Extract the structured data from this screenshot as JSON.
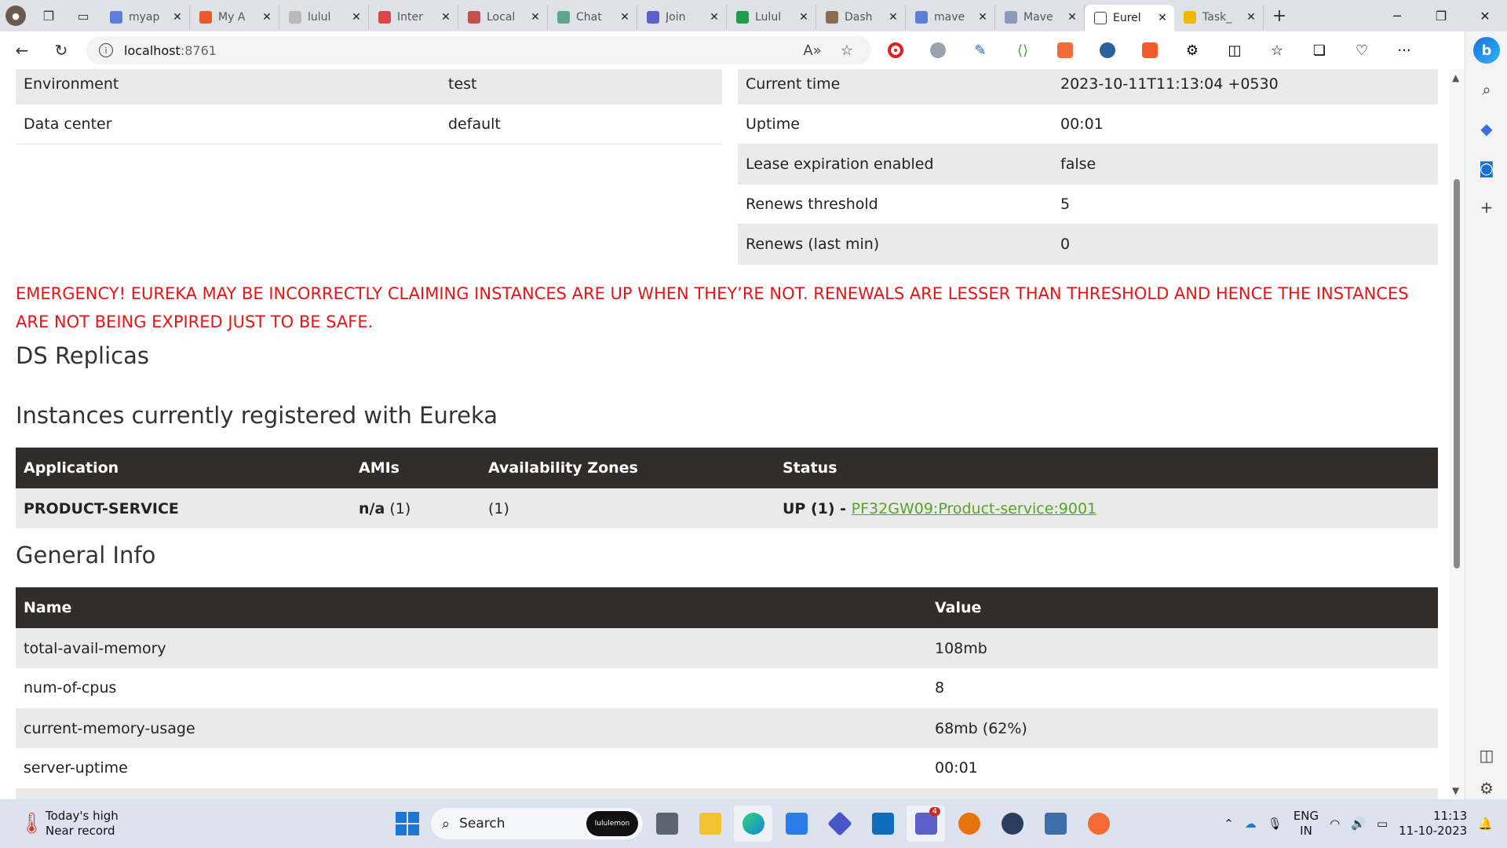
{
  "browser": {
    "tabs": [
      {
        "title": "myap",
        "color": "#5a7fd6",
        "glyph": "search-icon"
      },
      {
        "title": "My A",
        "color": "#e95b2b",
        "glyph": "grid-icon"
      },
      {
        "title": "lulul",
        "color": "#b9b9b9",
        "glyph": "globe-icon"
      },
      {
        "title": "Inter",
        "color": "#d74848",
        "glyph": "gauge-icon"
      },
      {
        "title": "Local",
        "color": "#c4504a",
        "glyph": "pdf-icon"
      },
      {
        "title": "Chat",
        "color": "#5aa88e",
        "glyph": "chat-icon"
      },
      {
        "title": "Join",
        "color": "#5b5fc7",
        "glyph": "teams-icon"
      },
      {
        "title": "Lulul",
        "color": "#1f9d4a",
        "glyph": "sheet-icon"
      },
      {
        "title": "Dash",
        "color": "#8a6c4e",
        "glyph": "person-icon"
      },
      {
        "title": "mave",
        "color": "#5a7fd6",
        "glyph": "search-icon"
      },
      {
        "title": "Mave",
        "color": "#8a9bb5",
        "glyph": "mvn-icon"
      },
      {
        "title": "Eurel",
        "color": "#ffffff",
        "glyph": "page-icon",
        "active": true
      },
      {
        "title": "Task_",
        "color": "#f2b600",
        "glyph": "slides-icon"
      }
    ],
    "address": {
      "host": "localhost",
      "port": ":8761"
    }
  },
  "status_left": [
    {
      "key": "Environment",
      "value": "test"
    },
    {
      "key": "Data center",
      "value": "default"
    }
  ],
  "status_right": [
    {
      "key": "Current time",
      "value": "2023-10-11T11:13:04 +0530"
    },
    {
      "key": "Uptime",
      "value": "00:01"
    },
    {
      "key": "Lease expiration enabled",
      "value": "false"
    },
    {
      "key": "Renews threshold",
      "value": "5"
    },
    {
      "key": "Renews (last min)",
      "value": "0"
    }
  ],
  "emergency_message": "EMERGENCY! EUREKA MAY BE INCORRECTLY CLAIMING INSTANCES ARE UP WHEN THEY’RE NOT. RENEWALS ARE LESSER THAN THRESHOLD AND HENCE THE INSTANCES ARE NOT BEING EXPIRED JUST TO BE SAFE.",
  "sections": {
    "replicas": "DS Replicas",
    "instances": "Instances currently registered with Eureka",
    "general": "General Info"
  },
  "instances": {
    "headers": [
      "Application",
      "AMIs",
      "Availability Zones",
      "Status"
    ],
    "rows": [
      {
        "application": "PRODUCT-SERVICE",
        "amis_bold": "n/a",
        "amis_count": " (1)",
        "zones": "(1)",
        "status_prefix": "UP (1) - ",
        "status_link": "PF32GW09:Product-service:9001"
      }
    ]
  },
  "general_info": {
    "headers": [
      "Name",
      "Value"
    ],
    "rows": [
      {
        "name": "total-avail-memory",
        "value": "108mb"
      },
      {
        "name": "num-of-cpus",
        "value": "8"
      },
      {
        "name": "current-memory-usage",
        "value": "68mb (62%)"
      },
      {
        "name": "server-uptime",
        "value": "00:01"
      }
    ]
  },
  "taskbar": {
    "weather_line1": "Today's high",
    "weather_line2": "Near record",
    "search_label": "Search",
    "search_pill": "lululemon",
    "teams_badge": "4",
    "lang_line1": "ENG",
    "lang_line2": "IN",
    "time": "11:13",
    "date": "11-10-2023"
  }
}
